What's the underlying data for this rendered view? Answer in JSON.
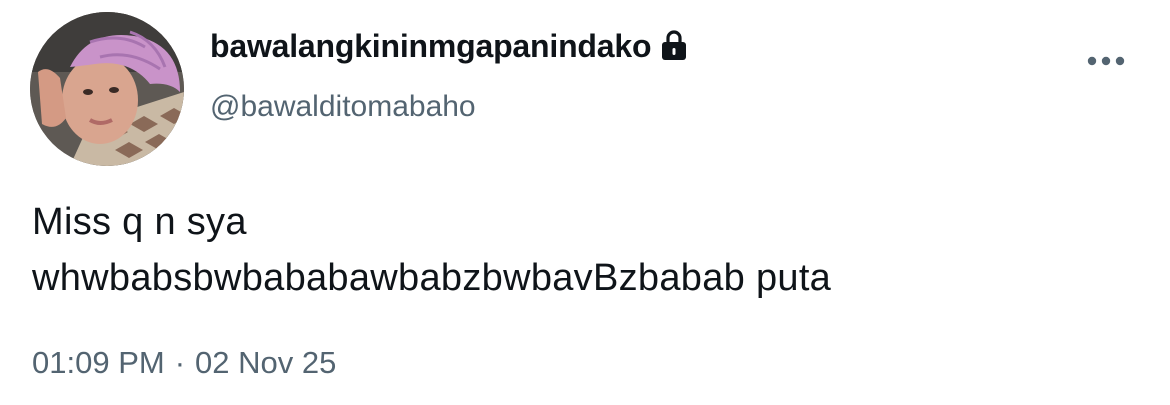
{
  "user": {
    "display_name": "bawalangkininmgapanindako",
    "handle": "@bawalditomabaho",
    "protected_icon": "lock-icon",
    "avatar_icon": "profile-photo"
  },
  "tweet": {
    "lines": [
      "Miss q n sya",
      "whwbabsbwbababawbabzbwbavBzbabab puta"
    ]
  },
  "meta": {
    "time": "01:09 PM",
    "separator": "·",
    "date": "02 Nov 25"
  },
  "actions": {
    "more_icon": "more-horizontal-icon"
  },
  "colors": {
    "text_primary": "#0f1419",
    "text_secondary": "#536471",
    "background": "#ffffff"
  }
}
